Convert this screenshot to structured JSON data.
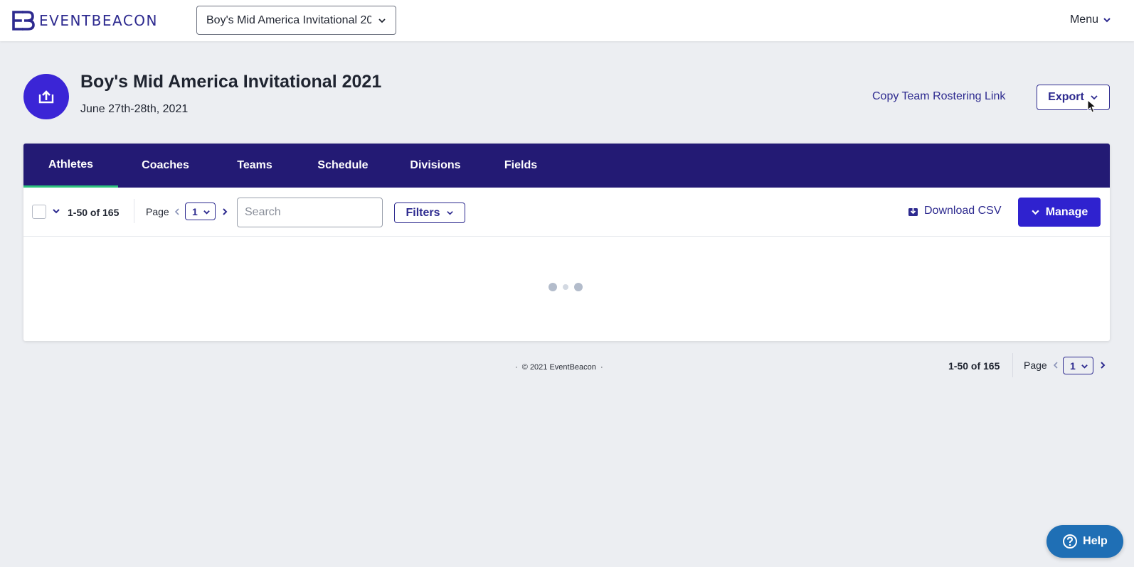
{
  "brand": {
    "name": "EVENTBEACON",
    "color": "#2d2a8f"
  },
  "topbar": {
    "event_select_value": "Boy's Mid America Invitational 2021",
    "menu_label": "Menu"
  },
  "event": {
    "title": "Boy's Mid America Invitational 2021",
    "dates": "June 27th-28th, 2021",
    "avatar_icon": "upload-icon",
    "avatar_color": "#3b25d6"
  },
  "actions": {
    "copy_link_label": "Copy Team Rostering Link",
    "export_label": "Export"
  },
  "tabs": [
    {
      "label": "Athletes",
      "active": true
    },
    {
      "label": "Coaches",
      "active": false
    },
    {
      "label": "Teams",
      "active": false
    },
    {
      "label": "Schedule",
      "active": false
    },
    {
      "label": "Divisions",
      "active": false
    },
    {
      "label": "Fields",
      "active": false
    }
  ],
  "toolbar": {
    "count_label": "1-50 of 165",
    "page_label": "Page",
    "page_value": "1",
    "search_placeholder": "Search",
    "search_value": "",
    "filters_label": "Filters",
    "download_label": "Download CSV",
    "manage_label": "Manage"
  },
  "footer": {
    "copyright": "© 2021 EventBeacon",
    "count_label": "1-50 of 165",
    "page_label": "Page",
    "page_value": "1"
  },
  "help": {
    "label": "Help"
  },
  "colors": {
    "tabs_bg": "#231a74",
    "active_tab_underline": "#2ec27e",
    "primary_button": "#2f22cf",
    "help_button": "#1f6fb5"
  }
}
